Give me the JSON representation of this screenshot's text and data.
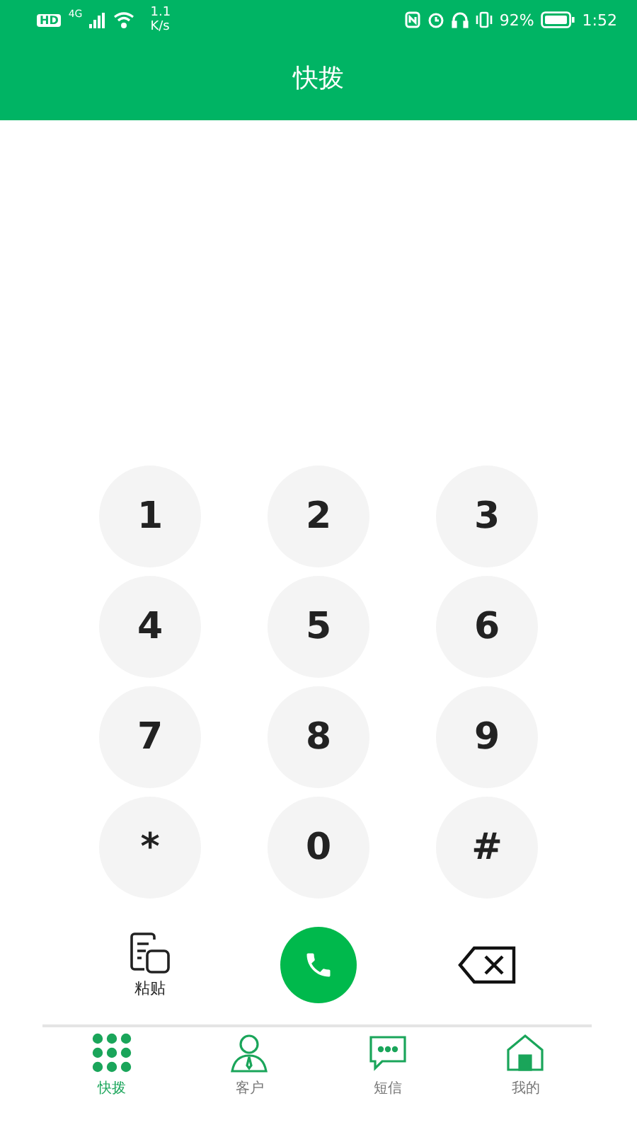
{
  "status_bar": {
    "hd": "HD",
    "network": "4G",
    "speed_value": "1.1",
    "speed_unit": "K/s",
    "battery": "92%",
    "time": "1:52"
  },
  "header": {
    "title": "快拨"
  },
  "keypad": [
    "1",
    "2",
    "3",
    "4",
    "5",
    "6",
    "7",
    "8",
    "9",
    "*",
    "0",
    "#"
  ],
  "actions": {
    "paste_label": "粘贴"
  },
  "tabs": [
    {
      "label": "快拨",
      "kind": "dial",
      "selected": true
    },
    {
      "label": "客户",
      "kind": "person",
      "selected": false
    },
    {
      "label": "短信",
      "kind": "message",
      "selected": false
    },
    {
      "label": "我的",
      "kind": "home",
      "selected": false
    }
  ]
}
